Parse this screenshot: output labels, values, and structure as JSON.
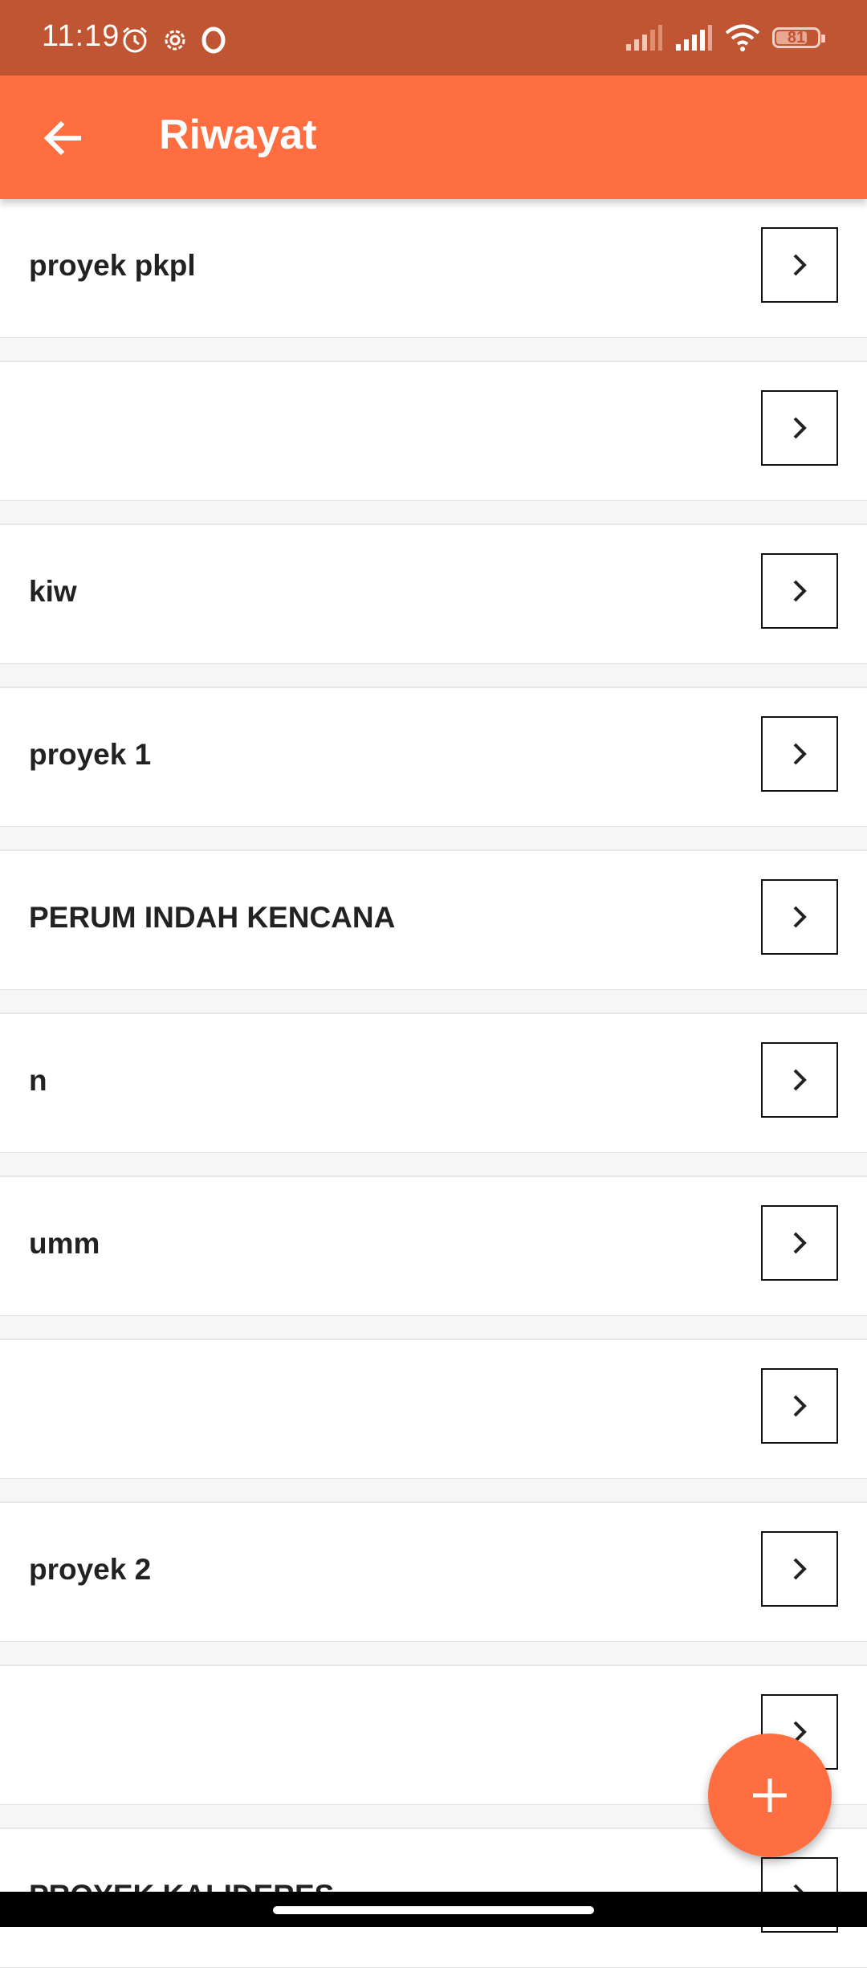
{
  "status_bar": {
    "time": "11:19",
    "battery": "81",
    "icons": [
      "alarm-icon",
      "settings-icon",
      "opera-icon",
      "signal-icon",
      "signal-icon",
      "wifi-icon",
      "battery-icon"
    ]
  },
  "app_bar": {
    "back_icon": "arrow-left-icon",
    "title": "Riwayat",
    "color": "#ff6e40"
  },
  "items": [
    {
      "label": "proyek pkpl"
    },
    {
      "label": ""
    },
    {
      "label": "kiw"
    },
    {
      "label": "proyek 1"
    },
    {
      "label": "PERUM INDAH KENCANA"
    },
    {
      "label": "n"
    },
    {
      "label": "umm"
    },
    {
      "label": ""
    },
    {
      "label": "proyek 2"
    },
    {
      "label": ""
    },
    {
      "label": "PROYEK KALIDERES"
    }
  ],
  "fab": {
    "icon": "plus-icon"
  }
}
